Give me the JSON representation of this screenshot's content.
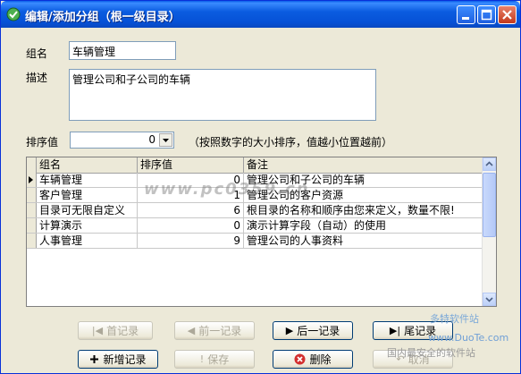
{
  "window": {
    "title": "编辑/添加分组（根一级目录）"
  },
  "form": {
    "group_name_label": "组名",
    "group_name_value": "车辆管理",
    "description_label": "描述",
    "description_value": "管理公司和子公司的车辆",
    "sort_label": "排序值",
    "sort_value": "0",
    "sort_hint": "（按照数字的大小排序，值越小位置越前）"
  },
  "grid": {
    "columns": [
      "组名",
      "排序值",
      "备注"
    ],
    "rows": [
      {
        "name": "车辆管理",
        "sort": "0",
        "note": "管理公司和子公司的车辆",
        "current": true
      },
      {
        "name": "客户管理",
        "sort": "1",
        "note": "管理公司的客户资源",
        "current": false
      },
      {
        "name": "目录可无限自定义",
        "sort": "6",
        "note": "根目录的名称和顺序由您来定义，数量不限!",
        "current": false
      },
      {
        "name": "计算演示",
        "sort": "0",
        "note": "演示计算字段（自动）的使用",
        "current": false
      },
      {
        "name": "人事管理",
        "sort": "9",
        "note": "管理公司的人事资料",
        "current": false
      }
    ]
  },
  "buttons": {
    "first": "首记录",
    "prev": "前一记录",
    "next": "后一记录",
    "last": "尾记录",
    "add": "新增记录",
    "save": "保存",
    "delete": "删除",
    "cancel": "取消"
  },
  "watermarks": {
    "site1": "多特软件站",
    "site2": "www.DuoTe.com",
    "site3": "国内最安全的软件站",
    "center": "www.pc0359.cn"
  }
}
